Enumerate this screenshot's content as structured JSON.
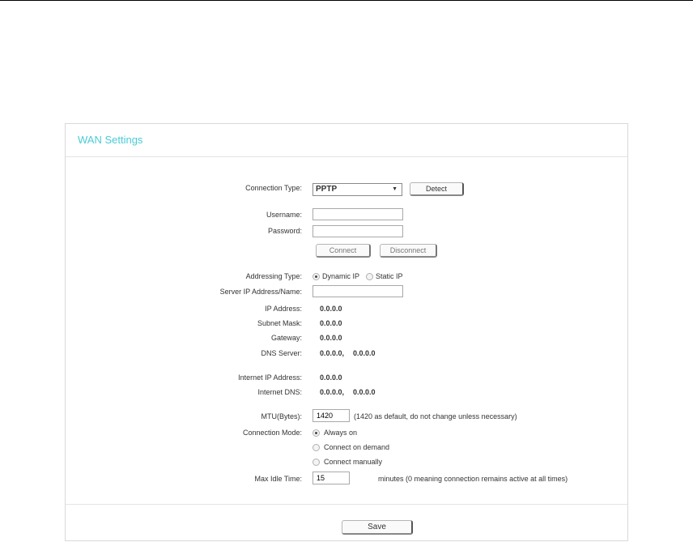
{
  "panel_title": "WAN Settings",
  "connection_type": {
    "label": "Connection Type:",
    "value": "PPTP",
    "detect_label": "Detect"
  },
  "username": {
    "label": "Username:",
    "value": ""
  },
  "password": {
    "label": "Password:",
    "value": ""
  },
  "connect_label": "Connect",
  "disconnect_label": "Disconnect",
  "addressing_type": {
    "label": "Addressing Type:",
    "options": [
      "Dynamic IP",
      "Static IP"
    ],
    "selected": "Dynamic IP"
  },
  "server_ip": {
    "label": "Server IP Address/Name:",
    "value": ""
  },
  "ip_address": {
    "label": "IP Address:",
    "value": "0.0.0.0"
  },
  "subnet_mask": {
    "label": "Subnet Mask:",
    "value": "0.0.0.0"
  },
  "gateway": {
    "label": "Gateway:",
    "value": "0.0.0.0"
  },
  "dns_server": {
    "label": "DNS Server:",
    "primary": "0.0.0.0,",
    "secondary": "0.0.0.0"
  },
  "internet_ip": {
    "label": "Internet IP Address:",
    "value": "0.0.0.0"
  },
  "internet_dns": {
    "label": "Internet DNS:",
    "primary": "0.0.0.0,",
    "secondary": "0.0.0.0"
  },
  "mtu": {
    "label": "MTU(Bytes):",
    "value": "1420",
    "hint": "(1420 as default, do not change unless necessary)"
  },
  "connection_mode": {
    "label": "Connection Mode:",
    "options": [
      "Always on",
      "Connect on demand",
      "Connect manually"
    ],
    "selected": "Always on"
  },
  "max_idle": {
    "label": "Max Idle Time:",
    "value": "15",
    "hint": "minutes (0 meaning connection remains active at all times)"
  },
  "save_label": "Save"
}
